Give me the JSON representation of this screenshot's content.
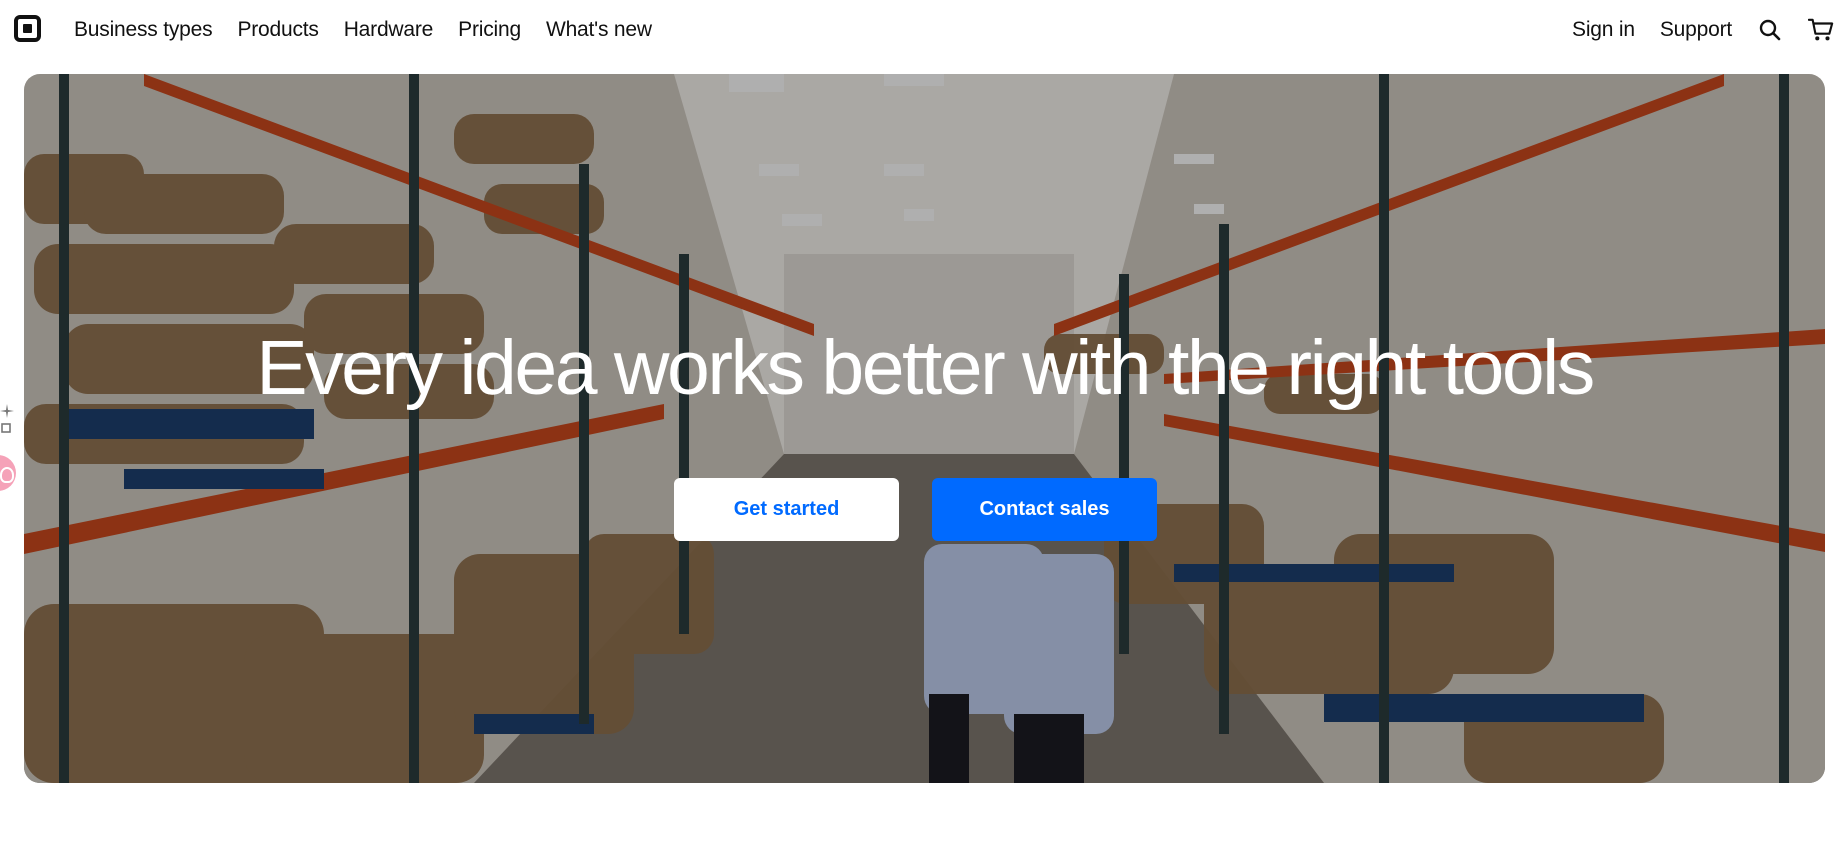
{
  "brand": {
    "logo_icon": "square-logo-icon"
  },
  "nav": {
    "left": [
      {
        "label": "Business types"
      },
      {
        "label": "Products"
      },
      {
        "label": "Hardware"
      },
      {
        "label": "Pricing"
      },
      {
        "label": "What's new"
      }
    ],
    "right": [
      {
        "label": "Sign in"
      },
      {
        "label": "Support"
      }
    ],
    "icons": [
      "search-icon",
      "cart-icon"
    ]
  },
  "hero": {
    "title": "Every idea works better with the right tools",
    "buttons": {
      "primary_outline": "Get started",
      "primary": "Contact sales"
    },
    "image_subject": "warehouse-with-burlap-sacks"
  },
  "colors": {
    "accent": "#006aff",
    "text": "#111111",
    "hero_overlay": "#00000047"
  }
}
